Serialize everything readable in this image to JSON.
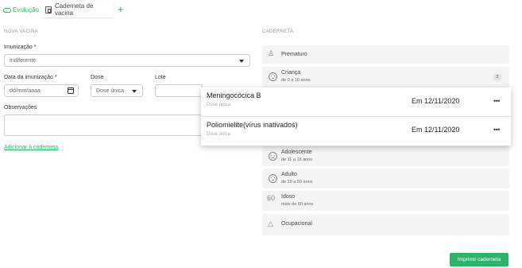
{
  "tabs": [
    {
      "label": "Evolução"
    },
    {
      "label": "Caderneta de vacina"
    }
  ],
  "add_tab_label": "+",
  "form": {
    "section_title": "NOVA VACINA",
    "imunizacao": {
      "label": "Imunização *",
      "value": "Indiferente"
    },
    "data": {
      "label": "Data da imunização *",
      "placeholder": "dd/mm/aaaa"
    },
    "dose": {
      "label": "Dose",
      "value": "Dose única"
    },
    "lote": {
      "label": "Lote",
      "value": ""
    },
    "observacoes": {
      "label": "Observações"
    },
    "add_link": "Adicionar à caderneta"
  },
  "caderneta": {
    "section_title": "CADERNETA",
    "items": [
      {
        "title": "Prematuro",
        "subtitle": "",
        "icon": "baby-icon"
      },
      {
        "title": "Criança",
        "subtitle": "de 0 a 10 anos",
        "badge": "2",
        "icon": "child-face-icon"
      },
      {
        "title": "Adolescente",
        "subtitle": "de 11 a 19 anos",
        "icon": "teen-face-icon"
      },
      {
        "title": "Adulto",
        "subtitle": "de 20 a 59 anos",
        "icon": "adult-face-icon"
      },
      {
        "title": "Idoso",
        "subtitle": "mais de 60 anos",
        "icon": "elder-icon"
      },
      {
        "title": "Ocupacional",
        "subtitle": "",
        "icon": "helmet-icon"
      }
    ],
    "elder_icon_text": "60"
  },
  "popup": {
    "rows": [
      {
        "name": "Meningocócica B",
        "dose": "Dose única",
        "date": "Em 12/11/2020",
        "more": "•••"
      },
      {
        "name": "Poliomielite(vírus inativados)",
        "dose": "Dose única",
        "date": "Em 12/11/2020",
        "more": "•••"
      }
    ]
  },
  "print_button": "Imprimir caderneta",
  "colors": {
    "accent": "#2bb36a"
  }
}
